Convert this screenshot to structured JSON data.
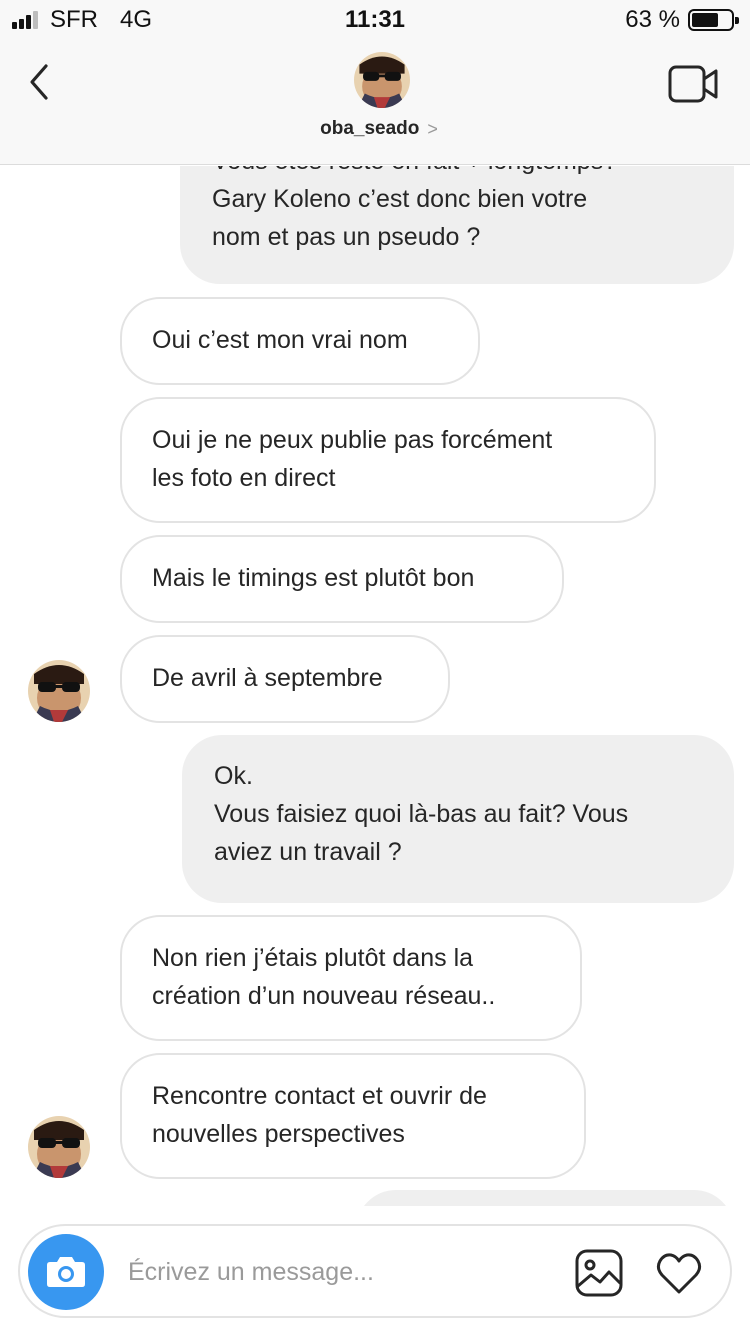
{
  "status_bar": {
    "carrier": "SFR",
    "network": "4G",
    "time": "11:31",
    "battery": "63 %"
  },
  "header": {
    "username": "oba_seado",
    "chevron": ">",
    "back_icon": "chevron-left-icon",
    "video_icon": "video-camera-icon"
  },
  "messages": [
    {
      "side": "out",
      "lines": [
        "Vous êtes resté en fait + longtemps?",
        "Gary Koleno c’est donc bien votre",
        "nom et pas un pseudo ?"
      ]
    },
    {
      "side": "in",
      "lines": [
        "Oui c’est mon vrai nom"
      ]
    },
    {
      "side": "in",
      "lines": [
        "Oui je ne peux publie pas forcément",
        "les foto en direct"
      ]
    },
    {
      "side": "in",
      "lines": [
        "Mais le timings est plutôt bon"
      ]
    },
    {
      "side": "in",
      "lines": [
        "De avril à septembre"
      ]
    },
    {
      "side": "out",
      "lines": [
        "Ok.",
        "Vous faisiez quoi là-bas au fait? Vous",
        "aviez un travail ?"
      ]
    },
    {
      "side": "in",
      "lines": [
        "Non rien j’étais plutôt dans la",
        "création d’un nouveau réseau.."
      ]
    },
    {
      "side": "in",
      "lines": [
        "Rencontre contact et ouvrir de",
        "nouvelles perspectives"
      ]
    }
  ],
  "composer": {
    "placeholder": "Écrivez un message...",
    "camera_icon": "camera-icon",
    "gallery_icon": "image-icon",
    "like_icon": "heart-icon"
  },
  "colors": {
    "accent": "#3897f0",
    "outgoing_bubble": "#efefef",
    "incoming_border": "#e3e3e3"
  }
}
